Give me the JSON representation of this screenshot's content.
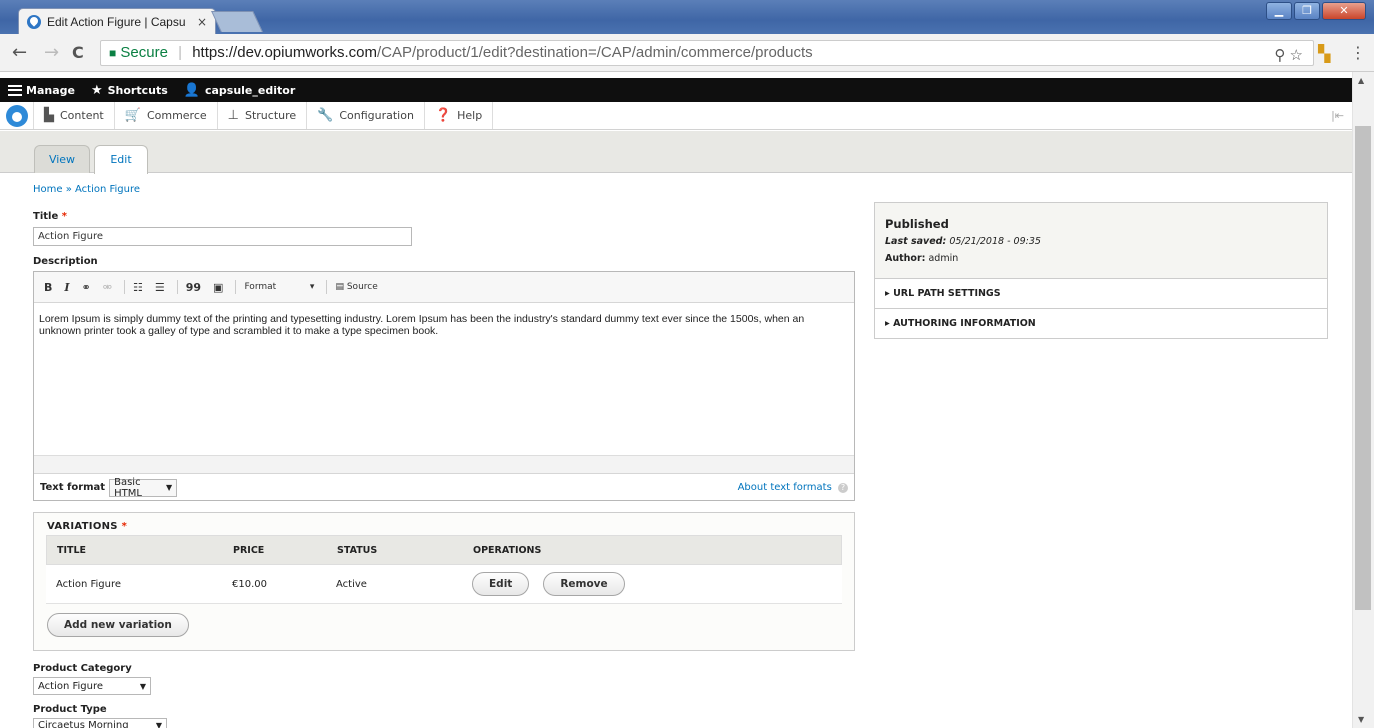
{
  "browser": {
    "tab_title": "Edit Action Figure | Capsu",
    "tab_close": "×",
    "url_secure": "Secure",
    "url_host": "https://dev.opiumworks.com",
    "url_path": "/CAP/product/1/edit?destination=/CAP/admin/commerce/products",
    "window_buttons": [
      "▁",
      "❐",
      "✕"
    ],
    "nav": {
      "back": "←",
      "forward": "→",
      "reload": "C"
    },
    "url_actions": {
      "zoom": "⚲",
      "star": "☆"
    },
    "menu": "⋮"
  },
  "toolbar": {
    "manage": "Manage",
    "shortcuts": "Shortcuts",
    "user": "capsule_editor"
  },
  "tray": {
    "items": [
      "Content",
      "Commerce",
      "Structure",
      "Configuration",
      "Help"
    ],
    "collapse": "|⇤"
  },
  "tabs": {
    "view": "View",
    "edit": "Edit"
  },
  "breadcrumb": "Home » Action Figure",
  "title_field": {
    "label": "Title",
    "required": "*",
    "value": "Action Figure"
  },
  "description": {
    "label": "Description",
    "toolbar": {
      "bold": "B",
      "italic": "I",
      "link": "⚭",
      "unlink": "⚮",
      "bullet_list": "☷",
      "numbered_list": "☰",
      "blockquote": "99",
      "image": "▣",
      "format": "Format",
      "format_caret": "▾",
      "source": "Source"
    },
    "body": "Lorem Ipsum is simply dummy text of the printing and typesetting industry. Lorem Ipsum has been the industry's standard dummy text ever since the 1500s, when an unknown printer took a galley of type and scrambled it to make a type specimen book.",
    "text_format_label": "Text format",
    "text_format_value": "Basic HTML",
    "about_formats": "About text formats"
  },
  "variations": {
    "title": "VARIATIONS",
    "required": "*",
    "columns": [
      "TITLE",
      "PRICE",
      "STATUS",
      "OPERATIONS"
    ],
    "rows": [
      {
        "title": "Action Figure",
        "price": "€10.00",
        "status": "Active",
        "edit": "Edit",
        "remove": "Remove"
      }
    ],
    "add_button": "Add new variation"
  },
  "product_category": {
    "label": "Product Category",
    "value": "Action Figure"
  },
  "product_type": {
    "label": "Product Type",
    "value": "Circaetus Morning"
  },
  "sidebar": {
    "status": "Published",
    "last_saved_label": "Last saved:",
    "last_saved_value": "05/21/2018 - 09:35",
    "author_label": "Author:",
    "author_value": "admin",
    "sections": [
      "URL PATH SETTINGS",
      "AUTHORING INFORMATION"
    ]
  }
}
